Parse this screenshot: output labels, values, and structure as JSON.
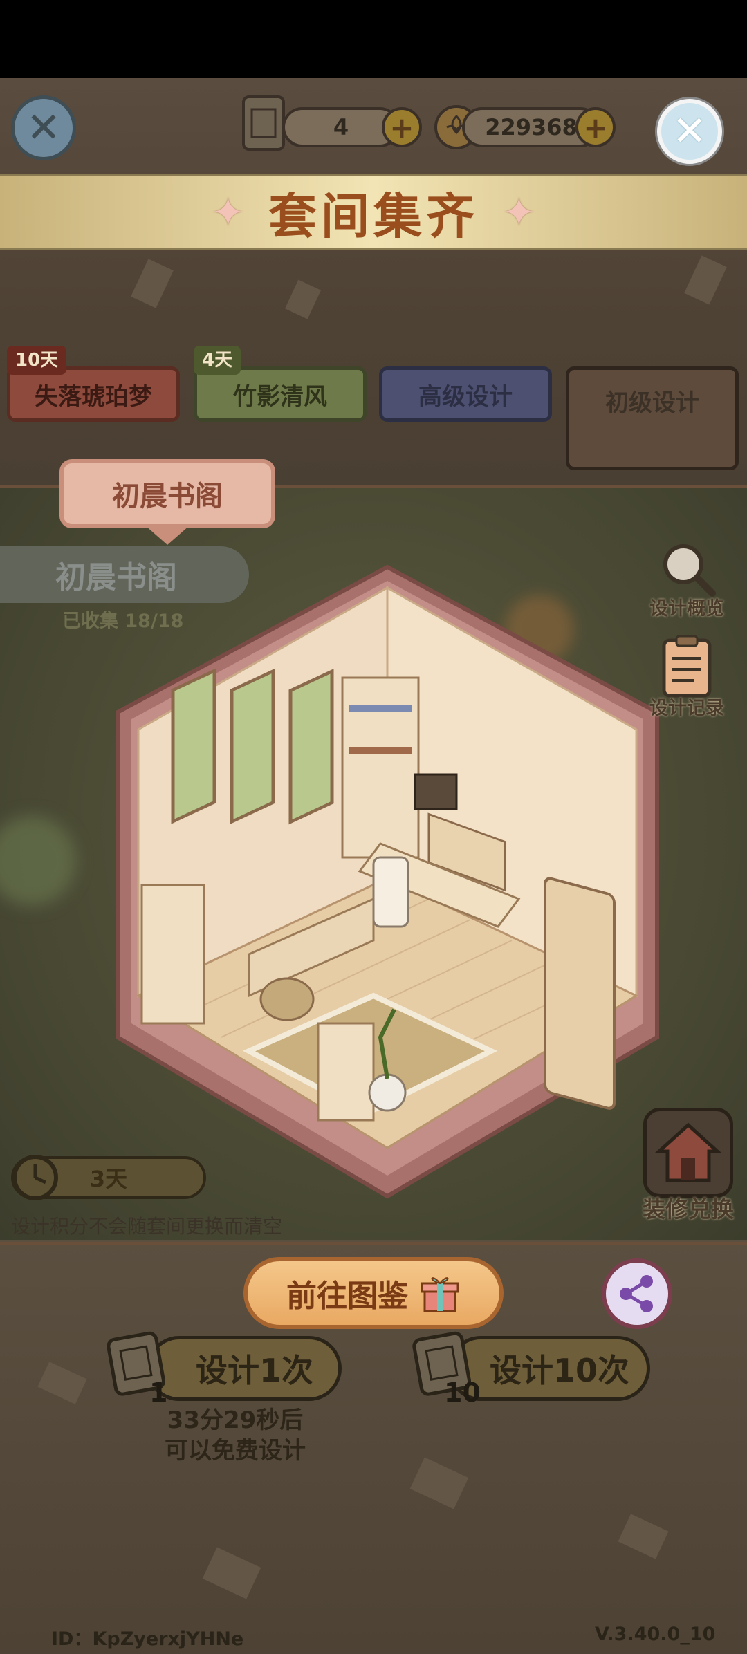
{
  "top_bar": {
    "scroll_count": "4",
    "coin_count": "229368"
  },
  "banner": {
    "title": "套间集齐"
  },
  "tabs": [
    {
      "label": "失落琥珀梦",
      "days": "10天"
    },
    {
      "label": "竹影清风",
      "days": "4天"
    },
    {
      "label": "高级设计"
    },
    {
      "label": "初级设计"
    }
  ],
  "room": {
    "tab_label": "初晨书阁",
    "name": "初晨书阁",
    "collected": "已收集 18/18"
  },
  "side_buttons": {
    "overview": "设计概览",
    "records": "设计记录",
    "exchange": "装修兑换"
  },
  "timer": {
    "remaining": "3天"
  },
  "points_note": "设计积分不会随套间更换而清空",
  "goto_catalog": "前往图鉴",
  "pull_once": {
    "label": "设计1次",
    "cost": "1"
  },
  "pull_ten": {
    "label": "设计10次",
    "cost": "10"
  },
  "free_note": [
    "33分29秒后",
    "可以免费设计"
  ],
  "footer": {
    "player_id": "ID：KpZyerxjYHNe",
    "version": "V.3.40.0_10"
  },
  "colors": {
    "title": "#9a4e1e",
    "banner_gold": "#f2e4b4",
    "room_frame": "#b98a86",
    "button_orange": "#e9a963"
  }
}
